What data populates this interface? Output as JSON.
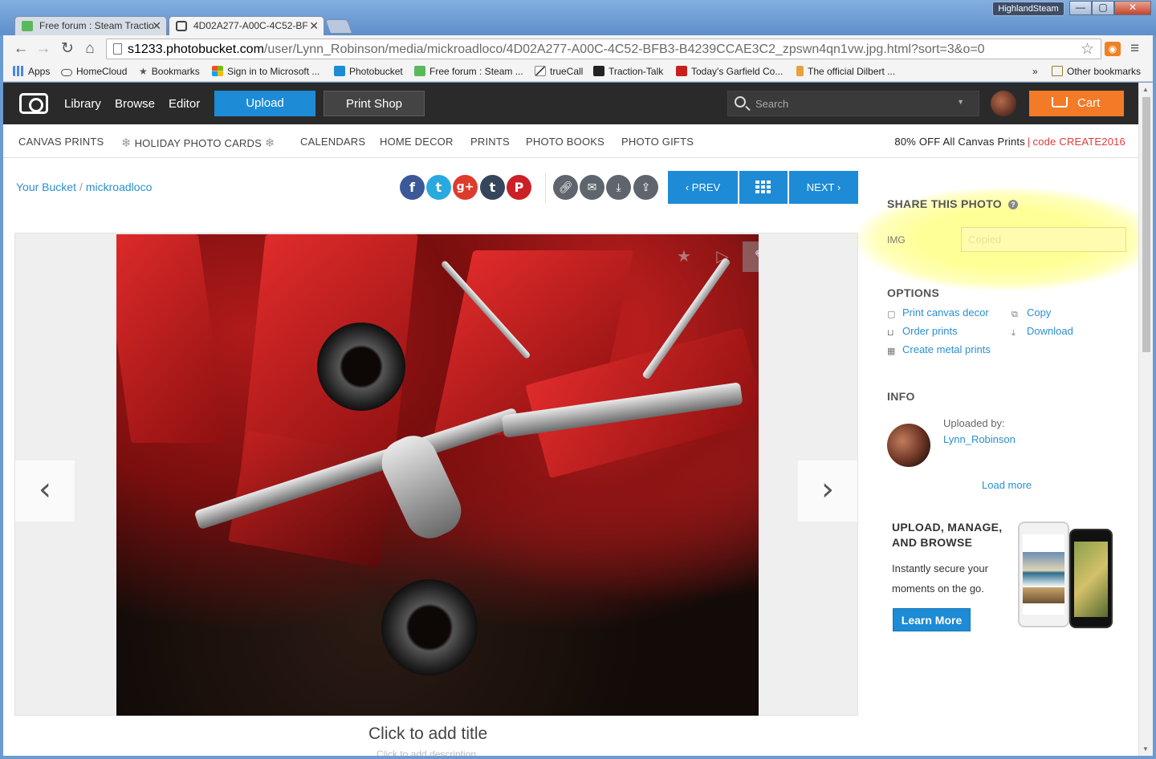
{
  "browser": {
    "tabs": [
      {
        "title": "Free forum : Steam Tractio"
      },
      {
        "title": "4D02A277-A00C-4C52-BF"
      }
    ],
    "profile": "HighlandSteam",
    "url_host": "s1233.photobucket.com",
    "url_path": "/user/Lynn_Robinson/media/mickroadloco/4D02A277-A00C-4C52-BFB3-B4239CCAE3C2_zpswn4qn1vw.jpg.html?sort=3&o=0",
    "bookmarks": [
      {
        "label": "Apps",
        "icon": "apps-grid-icon",
        "color": "#4a86e8"
      },
      {
        "label": "HomeCloud",
        "icon": "cloud-icon",
        "color": "#555555"
      },
      {
        "label": "Bookmarks",
        "icon": "star-icon",
        "color": "#555555"
      },
      {
        "label": "Sign in to Microsoft ...",
        "icon": "microsoft-icon",
        "color": "#f25022"
      },
      {
        "label": "Photobucket",
        "icon": "photobucket-icon",
        "color": "#1e8bd6"
      },
      {
        "label": "Free forum : Steam ...",
        "icon": "forum-icon",
        "color": "#5cb85c"
      },
      {
        "label": "trueCall",
        "icon": "truecall-icon",
        "color": "#444444"
      },
      {
        "label": "Traction-Talk",
        "icon": "tt-icon",
        "color": "#222222"
      },
      {
        "label": "Today's Garfield Co...",
        "icon": "garfield-icon",
        "color": "#c81e1e"
      },
      {
        "label": "The official Dilbert ...",
        "icon": "dilbert-icon",
        "color": "#e8a23a"
      }
    ],
    "more_bookmarks": "»",
    "other_bookmarks": "Other bookmarks"
  },
  "header": {
    "nav": [
      "Library",
      "Browse",
      "Editor"
    ],
    "upload": "Upload",
    "print_shop": "Print Shop",
    "search_placeholder": "Search",
    "cart": "Cart"
  },
  "subnav": {
    "items": [
      "CANVAS PRINTS",
      "HOLIDAY PHOTO CARDS",
      "CALENDARS",
      "HOME DECOR",
      "PRINTS",
      "PHOTO BOOKS",
      "PHOTO GIFTS"
    ],
    "promo_text": "80% OFF All Canvas Prints",
    "promo_sep": "|",
    "promo_code": "code CREATE2016"
  },
  "breadcrumb": {
    "root": "Your Bucket",
    "sep": "/",
    "album": "mickroadloco"
  },
  "social": [
    {
      "glyph": "f",
      "color": "#3b5998"
    },
    {
      "glyph": "t",
      "color": "#2aa9e0"
    },
    {
      "glyph": "g+",
      "color": "#dd3b2b"
    },
    {
      "glyph": "t",
      "color": "#35465c"
    },
    {
      "glyph": "P",
      "color": "#cb2027"
    }
  ],
  "pager": {
    "prev": "‹ PREV",
    "next": "NEXT ›"
  },
  "photo": {
    "title": "Click to add title",
    "description": "Click to add description"
  },
  "share": {
    "heading": "SHARE THIS PHOTO",
    "img_label": "IMG",
    "input_value": "Copied"
  },
  "options": {
    "heading": "OPTIONS",
    "print_canvas": "Print canvas decor",
    "order_prints": "Order prints",
    "metal_prints": "Create metal prints",
    "copy": "Copy",
    "download": "Download"
  },
  "info": {
    "heading": "INFO",
    "uploaded_by": "Uploaded by:",
    "uploader": "Lynn_Robinson",
    "load_more": "Load more"
  },
  "promo": {
    "title": "UPLOAD, MANAGE, AND BROWSE",
    "text": "Instantly secure your moments on the go.",
    "cta": "Learn More"
  }
}
